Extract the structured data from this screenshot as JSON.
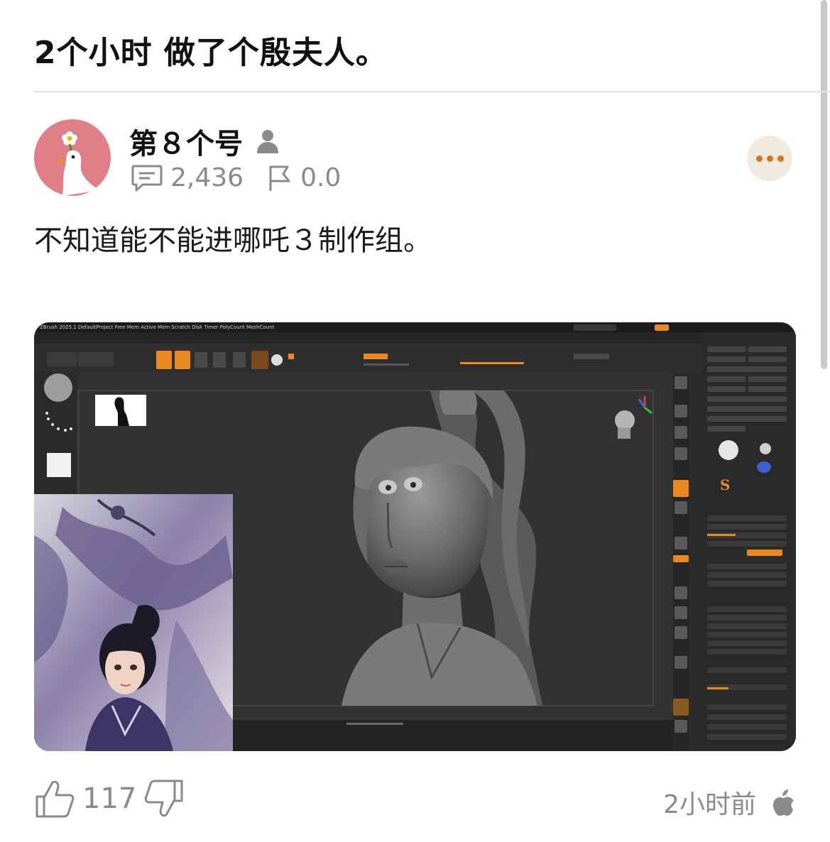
{
  "post": {
    "title": "2个小时 做了个殷夫人。",
    "body": "不知道能不能进哪吒３制作组。",
    "image_icon": "zbrush-sculpt-screenshot"
  },
  "author": {
    "name": "第８个号",
    "avatar_icon": "goose-flower-avatar-icon",
    "badge_icon": "person-icon"
  },
  "stats": {
    "comments": "2,436",
    "comment_icon": "comment-icon",
    "flag_score": "0.0",
    "flag_icon": "flag-icon"
  },
  "more_menu": {
    "icon": "more-dots-icon"
  },
  "reactions": {
    "likes": "117",
    "like_icon": "thumbs-up-icon",
    "dislike_icon": "thumbs-down-icon"
  },
  "timestamp": "2小时前",
  "platform_icon": "apple-icon",
  "colors": {
    "accent": "#d9711e",
    "avatar_bg": "#e07f87",
    "muted_text": "#8a8a8a",
    "zbrush_orange": "#e8881e"
  }
}
